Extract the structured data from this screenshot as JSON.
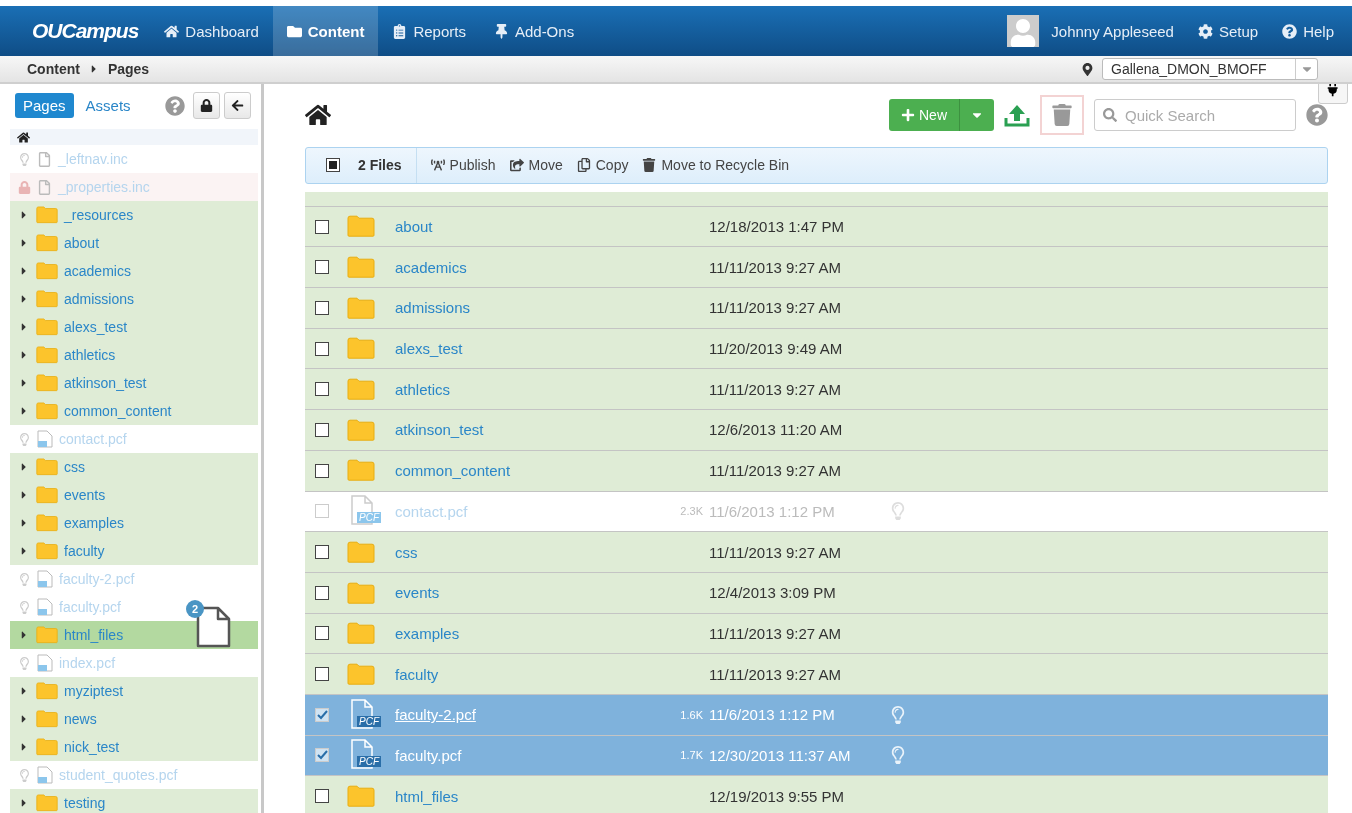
{
  "top_bar": {
    "logo": "OUCampus",
    "nav": [
      {
        "label": "Dashboard",
        "selected": false
      },
      {
        "label": "Content",
        "selected": true
      },
      {
        "label": "Reports",
        "selected": false
      },
      {
        "label": "Add-Ons",
        "selected": false
      }
    ],
    "user": "Johnny Appleseed",
    "setup": "Setup",
    "help": "Help"
  },
  "breadcrumb": [
    "Content",
    "Pages"
  ],
  "site_select": {
    "value": "Gallena_DMON_BMOFF"
  },
  "sidebar": {
    "tabs": [
      {
        "label": "Pages",
        "selected": true
      },
      {
        "label": "Assets",
        "selected": false
      }
    ],
    "items": [
      {
        "kind": "file",
        "name": "_leftnav.inc",
        "locked": false,
        "highlighted": false
      },
      {
        "kind": "file",
        "name": "_properties.inc",
        "locked": true,
        "highlighted": false
      },
      {
        "kind": "folder",
        "name": "_resources",
        "highlighted": false
      },
      {
        "kind": "folder",
        "name": "about",
        "highlighted": false
      },
      {
        "kind": "folder",
        "name": "academics",
        "highlighted": false
      },
      {
        "kind": "folder",
        "name": "admissions",
        "highlighted": false
      },
      {
        "kind": "folder",
        "name": "alexs_test",
        "highlighted": false
      },
      {
        "kind": "folder",
        "name": "athletics",
        "highlighted": false
      },
      {
        "kind": "folder",
        "name": "atkinson_test",
        "highlighted": false
      },
      {
        "kind": "folder",
        "name": "common_content",
        "highlighted": false
      },
      {
        "kind": "pcf",
        "name": "contact.pcf",
        "locked": false,
        "highlighted": false
      },
      {
        "kind": "folder",
        "name": "css",
        "highlighted": false
      },
      {
        "kind": "folder",
        "name": "events",
        "highlighted": false
      },
      {
        "kind": "folder",
        "name": "examples",
        "highlighted": false
      },
      {
        "kind": "folder",
        "name": "faculty",
        "highlighted": false
      },
      {
        "kind": "pcf",
        "name": "faculty-2.pcf",
        "locked": false,
        "highlighted": false
      },
      {
        "kind": "pcf",
        "name": "faculty.pcf",
        "locked": false,
        "highlighted": false
      },
      {
        "kind": "folder",
        "name": "html_files",
        "highlighted": true
      },
      {
        "kind": "pcf",
        "name": "index.pcf",
        "locked": false,
        "highlighted": false
      },
      {
        "kind": "folder",
        "name": "myziptest",
        "highlighted": false
      },
      {
        "kind": "folder",
        "name": "news",
        "highlighted": false
      },
      {
        "kind": "folder",
        "name": "nick_test",
        "highlighted": false
      },
      {
        "kind": "pcf",
        "name": "student_quotes.pcf",
        "locked": false,
        "highlighted": false
      },
      {
        "kind": "folder",
        "name": "testing",
        "highlighted": false
      }
    ],
    "drag": {
      "count": "2"
    }
  },
  "toolbar": {
    "new_button": "New",
    "search": {
      "placeholder": "Quick Search"
    }
  },
  "action_bar": {
    "select_all_checked": true,
    "count": "2 Files",
    "actions": [
      "Publish",
      "Move",
      "Copy",
      "Move to Recycle Bin"
    ]
  },
  "table": {
    "rows": [
      {
        "kind": "folder",
        "checked": false,
        "name": "about",
        "date": "12/18/2013 1:47 PM"
      },
      {
        "kind": "folder",
        "checked": false,
        "name": "academics",
        "date": "11/11/2013 9:27 AM"
      },
      {
        "kind": "folder",
        "checked": false,
        "name": "admissions",
        "date": "11/11/2013 9:27 AM"
      },
      {
        "kind": "folder",
        "checked": false,
        "name": "alexs_test",
        "date": "11/20/2013 9:49 AM"
      },
      {
        "kind": "folder",
        "checked": false,
        "name": "athletics",
        "date": "11/11/2013 9:27 AM"
      },
      {
        "kind": "folder",
        "checked": false,
        "name": "atkinson_test",
        "date": "12/6/2013 11:20 AM"
      },
      {
        "kind": "folder",
        "checked": false,
        "name": "common_content",
        "date": "11/11/2013 9:27 AM"
      },
      {
        "kind": "pcf",
        "checked": false,
        "name": "contact.pcf",
        "badge": "PCF",
        "size": "2.3K",
        "date": "11/6/2013 1:12 PM"
      },
      {
        "kind": "folder",
        "checked": false,
        "name": "css",
        "date": "11/11/2013 9:27 AM"
      },
      {
        "kind": "folder",
        "checked": false,
        "name": "events",
        "date": "12/4/2013 3:09 PM"
      },
      {
        "kind": "folder",
        "checked": false,
        "name": "examples",
        "date": "11/11/2013 9:27 AM"
      },
      {
        "kind": "folder",
        "checked": false,
        "name": "faculty",
        "date": "11/11/2013 9:27 AM"
      },
      {
        "kind": "pcf",
        "checked": true,
        "name": "faculty-2.pcf",
        "badge": "PCF",
        "size": "1.6K",
        "date": "11/6/2013 1:12 PM"
      },
      {
        "kind": "pcf",
        "checked": true,
        "name": "faculty.pcf",
        "badge": "PCF",
        "size": "1.7K",
        "date": "12/30/2013 11:37 AM"
      },
      {
        "kind": "folder",
        "checked": false,
        "name": "html_files",
        "date": "12/19/2013 9:55 PM"
      }
    ]
  }
}
